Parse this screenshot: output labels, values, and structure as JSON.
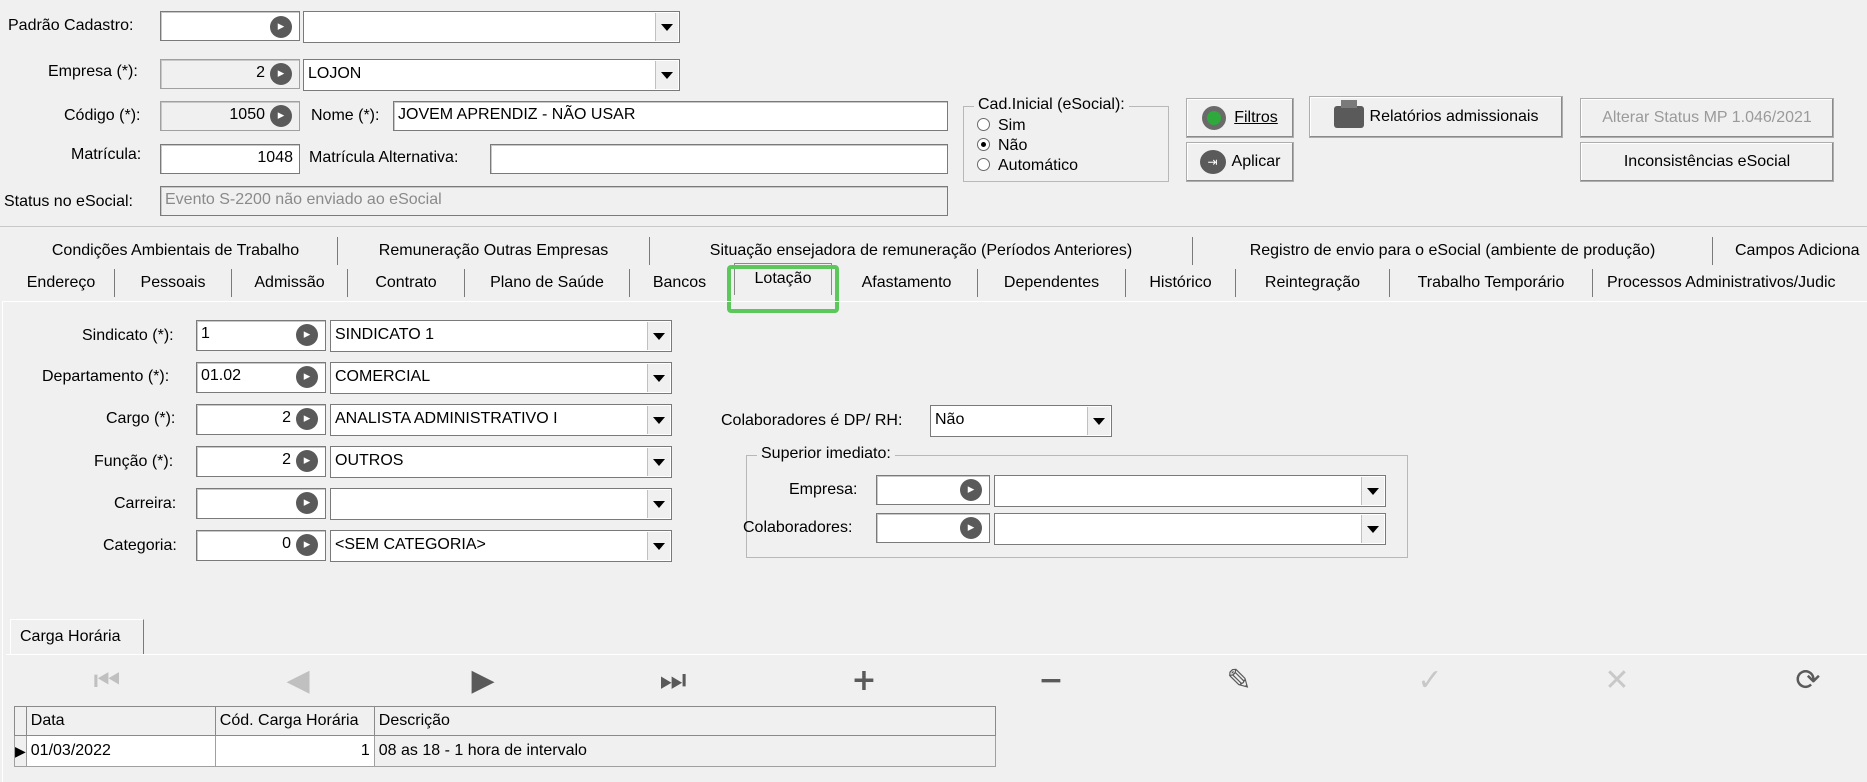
{
  "header": {
    "padrao_label": "Padrão Cadastro:",
    "empresa_label": "Empresa (*):",
    "empresa_code": "2",
    "empresa_name": "LOJON",
    "codigo_label": "Código (*):",
    "codigo_value": "1050",
    "nome_label": "Nome (*):",
    "nome_value": "JOVEM APRENDIZ -  NÃO USAR",
    "matricula_label": "Matrícula:",
    "matricula_value": "1048",
    "matricula_alt_label": "Matrícula Alternativa:",
    "status_label": "Status no eSocial:",
    "status_value": "Evento S-2200 não enviado ao eSocial"
  },
  "cad_inicial": {
    "legend": "Cad.Inicial (eSocial):",
    "options": [
      "Sim",
      "Não",
      "Automático"
    ],
    "selected": "Não"
  },
  "buttons": {
    "filtros": "Filtros",
    "aplicar": "Aplicar",
    "relatorios": "Relatórios admissionais",
    "alterar_status": "Alterar Status MP 1.046/2021",
    "inconsistencias": "Inconsistências eSocial"
  },
  "tabs_row1": [
    "Condições Ambientais de Trabalho",
    "Remuneração Outras Empresas",
    "Situação ensejadora de remuneração (Períodos Anteriores)",
    "Registro de envio para o eSocial (ambiente de produção)",
    "Campos Adiciona"
  ],
  "tabs_row2": [
    "Endereço",
    "Pessoais",
    "Admissão",
    "Contrato",
    "Plano de Saúde",
    "Bancos",
    "Lotação",
    "Afastamento",
    "Dependentes",
    "Histórico",
    "Reintegração",
    "Trabalho Temporário",
    "Processos Administrativos/Judic"
  ],
  "active_tab": "Lotação",
  "lotacao": {
    "sindicato_label": "Sindicato (*):",
    "sindicato_code": "1",
    "sindicato_name": "SINDICATO 1",
    "departamento_label": "Departamento (*):",
    "departamento_code": "01.02",
    "departamento_name": "COMERCIAL",
    "cargo_label": "Cargo (*):",
    "cargo_code": "2",
    "cargo_name": "ANALISTA ADMINISTRATIVO I",
    "funcao_label": "Função (*):",
    "funcao_code": "2",
    "funcao_name": "OUTROS",
    "carreira_label": "Carreira:",
    "carreira_code": "",
    "carreira_name": "",
    "categoria_label": "Categoria:",
    "categoria_code": "0",
    "categoria_name": "<SEM CATEGORIA>",
    "colab_dp_label": "Colaboradores é DP/ RH:",
    "colab_dp_value": "Não",
    "superior_legend": "Superior imediato:",
    "sup_empresa_label": "Empresa:",
    "sup_colab_label": "Colaboradores:"
  },
  "carga": {
    "tab_label": "Carga Horária",
    "columns": [
      "Data",
      "Cód. Carga Horária",
      "Descrição"
    ],
    "rows": [
      {
        "data": "01/03/2022",
        "codigo": "1",
        "descricao": "08 as 18 - 1 hora de intervalo"
      }
    ]
  },
  "colors": {
    "highlight": "#5cc85c",
    "filtros_icon": "#2eaa3c"
  }
}
